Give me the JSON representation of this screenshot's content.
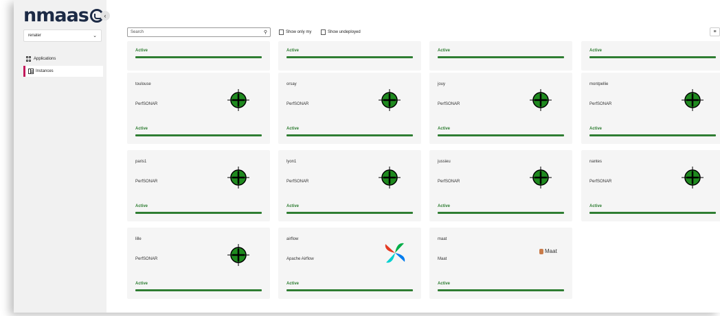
{
  "logo": {
    "text": "nmaas"
  },
  "sidebar": {
    "collapse": "‹",
    "tenant": "renater",
    "items": [
      {
        "label": "Applications",
        "icon": "grid-icon"
      },
      {
        "label": "Instances",
        "icon": "list-icon",
        "active": true
      }
    ]
  },
  "toolbar": {
    "search_placeholder": "Search",
    "show_only_my": "Show only my",
    "show_undeployed": "Show undeployed",
    "view_toggle": "≡"
  },
  "colors": {
    "accent": "#c2185b",
    "status_active": "#2e7d32",
    "card_bg": "#f5f5f5"
  },
  "top_row_status": [
    "Active",
    "Active",
    "Active",
    "Active"
  ],
  "instances": [
    {
      "name": "toulouse",
      "app": "PerfSONAR",
      "status": "Active",
      "icon": "perfsonar-icon"
    },
    {
      "name": "orsay",
      "app": "PerfSONAR",
      "status": "Active",
      "icon": "perfsonar-icon"
    },
    {
      "name": "jouy",
      "app": "PerfSONAR",
      "status": "Active",
      "icon": "perfsonar-icon"
    },
    {
      "name": "montpellie",
      "app": "PerfSONAR",
      "status": "Active",
      "icon": "perfsonar-icon"
    },
    {
      "name": "paris1",
      "app": "PerfSONAR",
      "status": "Active",
      "icon": "perfsonar-icon"
    },
    {
      "name": "lyon1",
      "app": "PerfSONAR",
      "status": "Active",
      "icon": "perfsonar-icon"
    },
    {
      "name": "jussieu",
      "app": "PerfSONAR",
      "status": "Active",
      "icon": "perfsonar-icon"
    },
    {
      "name": "nantes",
      "app": "PerfSONAR",
      "status": "Active",
      "icon": "perfsonar-icon"
    },
    {
      "name": "lille",
      "app": "PerfSONAR",
      "status": "Active",
      "icon": "perfsonar-icon"
    },
    {
      "name": "airflow",
      "app": "Apache Airflow",
      "status": "Active",
      "icon": "airflow-icon"
    },
    {
      "name": "maat",
      "app": "Maat",
      "status": "Active",
      "icon": "maat-icon",
      "logo_text": "Maat"
    }
  ]
}
